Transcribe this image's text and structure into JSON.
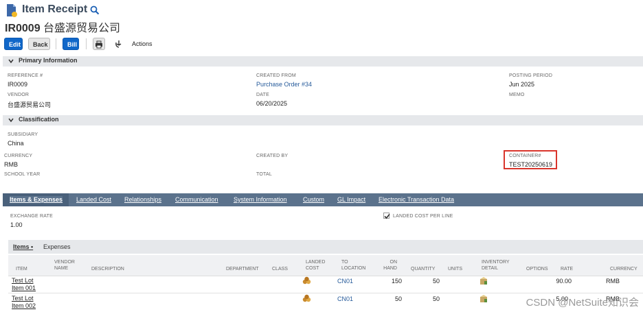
{
  "header": {
    "page_type": "Item Receipt",
    "record_id": "IR0009",
    "record_name": "台盛源贸易公司"
  },
  "toolbar": {
    "edit_label": "Edit",
    "back_label": "Back",
    "bill_label": "Bill",
    "actions_label": "Actions"
  },
  "primary": {
    "section_label": "Primary Information",
    "reference_label": "REFERENCE #",
    "reference_value": "IR0009",
    "vendor_label": "VENDOR",
    "vendor_value": "台盛源贸易公司",
    "created_from_label": "CREATED FROM",
    "created_from_value": "Purchase Order #34",
    "date_label": "DATE",
    "date_value": "06/20/2025",
    "posting_period_label": "POSTING PERIOD",
    "posting_period_value": "Jun 2025",
    "memo_label": "MEMO"
  },
  "classification": {
    "section_label": "Classification",
    "subsidiary_label": "SUBSIDIARY",
    "subsidiary_value": "China",
    "currency_label": "CURRENCY",
    "currency_value": "RMB",
    "school_year_label": "SCHOOL YEAR",
    "created_by_label": "CREATED BY",
    "total_label": "TOTAL",
    "container_label": "CONTAINER#",
    "container_value": "TEST20250619"
  },
  "tabs": [
    {
      "label": "Items & Expenses"
    },
    {
      "label": "Landed Cost"
    },
    {
      "label": "Relationships"
    },
    {
      "label": "Communication"
    },
    {
      "label": "System Information"
    },
    {
      "label": "Custom"
    },
    {
      "label": "GL Impact"
    },
    {
      "label": "Electronic Transaction Data"
    }
  ],
  "items_tab": {
    "exchange_rate_label": "EXCHANGE RATE",
    "exchange_rate_value": "1.00",
    "landed_cost_per_line_label": "LANDED COST PER LINE",
    "landed_cost_per_line_checked": true,
    "subtab_items": "Items •",
    "subtab_expenses": "Expenses"
  },
  "grid": {
    "columns": {
      "item": "ITEM",
      "vendor_name_1": "VENDOR",
      "vendor_name_2": "NAME",
      "description": "DESCRIPTION",
      "department": "DEPARTMENT",
      "class": "CLASS",
      "landed_1": "LANDED",
      "landed_2": "COST",
      "to_1": "TO",
      "to_2": "LOCATION",
      "on_1": "ON",
      "on_2": "HAND",
      "quantity": "QUANTITY",
      "units": "UNITS",
      "inv_1": "INVENTORY",
      "inv_2": "DETAIL",
      "options": "OPTIONS",
      "rate": "RATE",
      "currency": "CURRENCY"
    },
    "rows": [
      {
        "item_1": "Test Lot",
        "item_2": "Item 001",
        "location": "CN01",
        "on_hand": "150",
        "quantity": "50",
        "rate": "90.00",
        "currency": "RMB"
      },
      {
        "item_1": "Test Lot",
        "item_2": "Item 002",
        "location": "CN01",
        "on_hand": "50",
        "quantity": "50",
        "rate": "5.00",
        "currency": "RMB"
      }
    ]
  },
  "watermark": "CSDN @NetSuite知识会",
  "colors": {
    "primary_button": "#1067c9",
    "tab_bar": "#5b728c",
    "highlight_box": "#d9342b",
    "link": "#255a9a"
  }
}
